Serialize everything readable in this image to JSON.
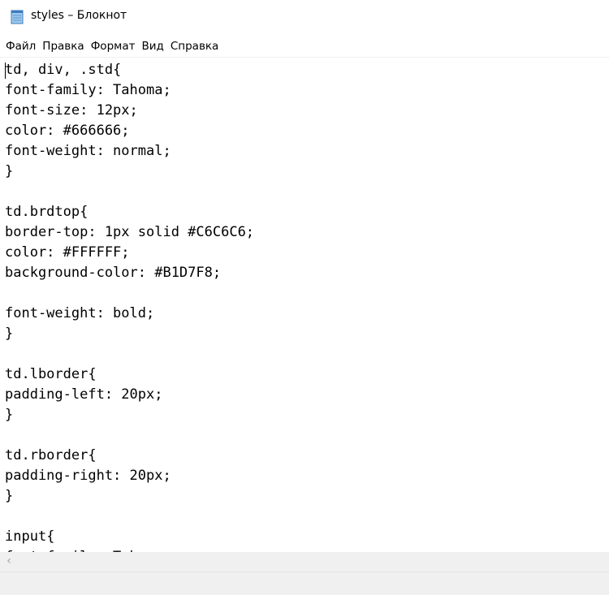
{
  "window": {
    "title": "styles – Блокнот",
    "icon": "notepad-icon"
  },
  "menu": {
    "items": [
      {
        "label": "Файл"
      },
      {
        "label": "Правка"
      },
      {
        "label": "Формат"
      },
      {
        "label": "Вид"
      },
      {
        "label": "Справка"
      }
    ]
  },
  "editor": {
    "lines": [
      "td, div, .std{",
      "font-family: Tahoma;",
      "font-size: 12px;",
      "color: #666666;",
      "font-weight: normal;",
      "}",
      "",
      "td.brdtop{",
      "border-top: 1px solid #C6C6C6;",
      "color: #FFFFFF;",
      "background-color: #B1D7F8;",
      "",
      "font-weight: bold;",
      "}",
      "",
      "td.lborder{",
      "padding-left: 20px;",
      "}",
      "",
      "td.rborder{",
      "padding-right: 20px;",
      "}",
      "",
      "input{",
      "font-family: Tahoma;"
    ]
  },
  "scrollbar": {
    "left_arrow": "‹",
    "icon": "chevron-left-icon"
  }
}
